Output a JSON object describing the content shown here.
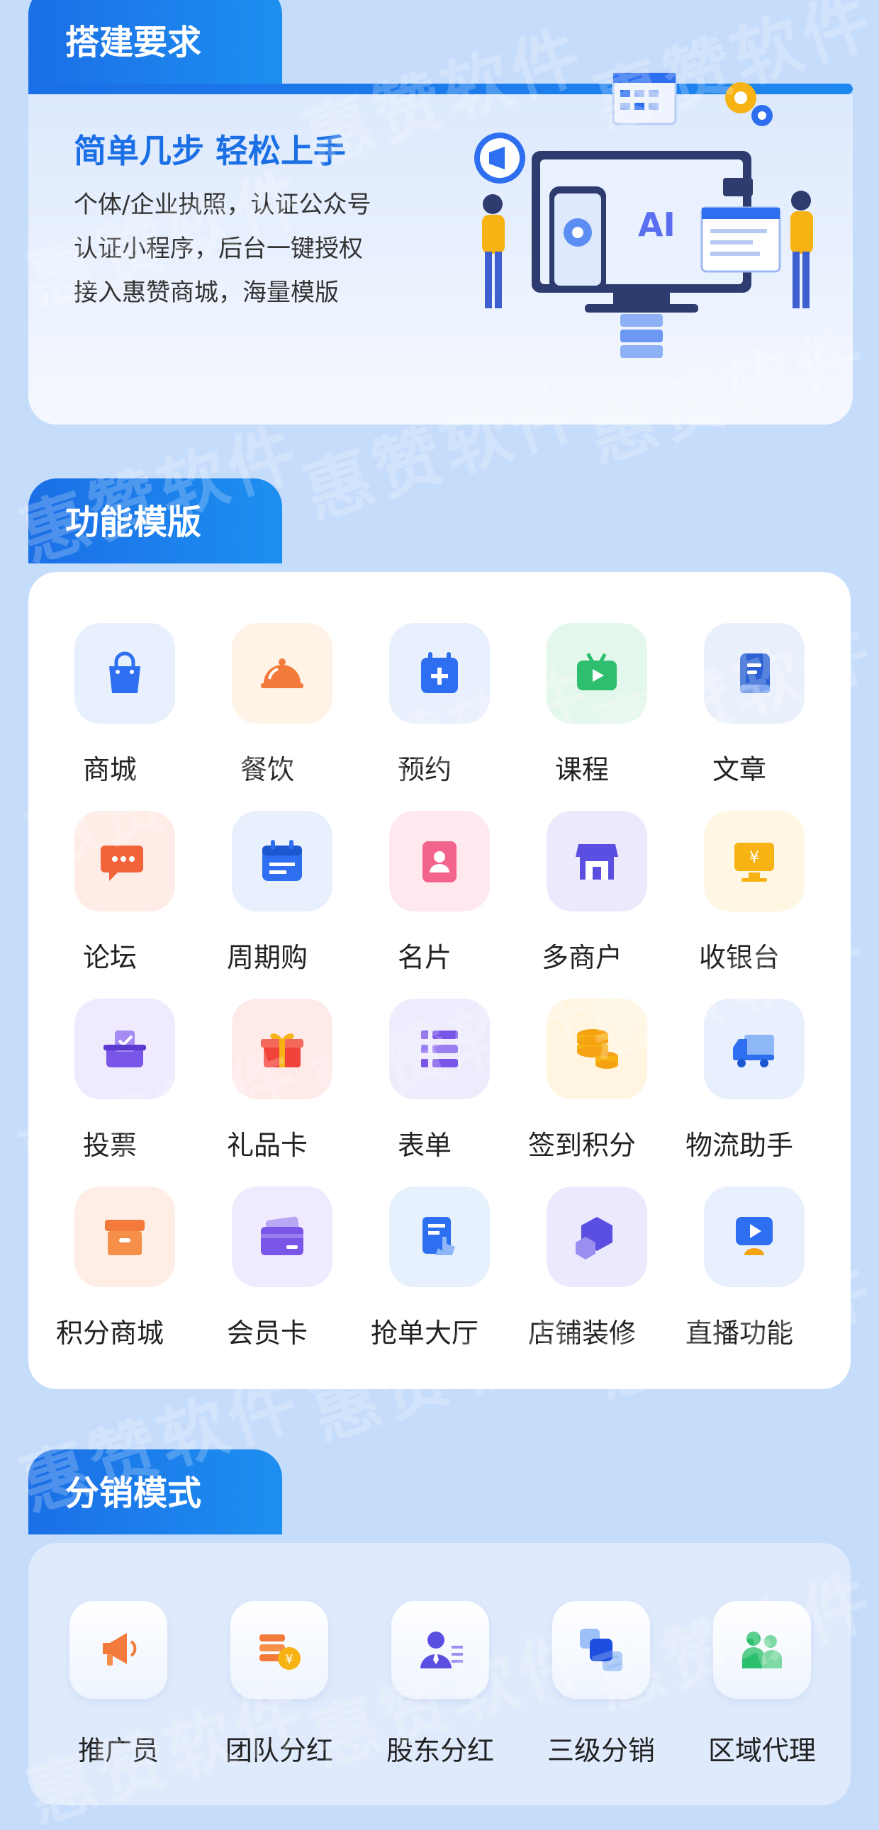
{
  "watermark": "惠赞软件",
  "section_setup": {
    "title": "搭建要求",
    "headline": "简单几步 轻松上手",
    "lines": [
      "个体/企业执照，认证公众号",
      "认证小程序，后台一键授权",
      "接入惠赞商城，海量模版"
    ],
    "illustration_text": "AI"
  },
  "section_templates": {
    "title": "功能模版",
    "items": [
      {
        "label": "商城",
        "icon": "shopping-bag-icon",
        "bg": "#e8effd"
      },
      {
        "label": "餐饮",
        "icon": "dining-cloche-icon",
        "bg": "#fff2e6"
      },
      {
        "label": "预约",
        "icon": "calendar-plus-icon",
        "bg": "#e8effd"
      },
      {
        "label": "课程",
        "icon": "tv-play-icon",
        "bg": "#e4f7ec"
      },
      {
        "label": "文章",
        "icon": "book-icon",
        "bg": "#eaf0fb"
      },
      {
        "label": "论坛",
        "icon": "chat-bubble-icon",
        "bg": "#ffece6"
      },
      {
        "label": "周期购",
        "icon": "calendar-icon",
        "bg": "#e8effd"
      },
      {
        "label": "名片",
        "icon": "id-card-icon",
        "bg": "#ffe9ee"
      },
      {
        "label": "多商户",
        "icon": "store-icon",
        "bg": "#ece9fd"
      },
      {
        "label": "收银台",
        "icon": "cashier-monitor-icon",
        "bg": "#fff7e3"
      },
      {
        "label": "投票",
        "icon": "ballot-box-icon",
        "bg": "#efeafd"
      },
      {
        "label": "礼品卡",
        "icon": "gift-icon",
        "bg": "#ffeaea"
      },
      {
        "label": "表单",
        "icon": "list-form-icon",
        "bg": "#eeebfd"
      },
      {
        "label": "签到积分",
        "icon": "coin-stack-icon",
        "bg": "#fff5e1"
      },
      {
        "label": "物流助手",
        "icon": "truck-icon",
        "bg": "#e8effd"
      },
      {
        "label": "积分商城",
        "icon": "storage-box-icon",
        "bg": "#ffeee6"
      },
      {
        "label": "会员卡",
        "icon": "member-card-icon",
        "bg": "#efeafd"
      },
      {
        "label": "抢单大厅",
        "icon": "order-tap-icon",
        "bg": "#e6f1fd"
      },
      {
        "label": "店铺装修",
        "icon": "cubes-icon",
        "bg": "#ebe9fd"
      },
      {
        "label": "直播功能",
        "icon": "live-play-icon",
        "bg": "#e8effd"
      }
    ]
  },
  "section_distribution": {
    "title": "分销模式",
    "items": [
      {
        "label": "推广员",
        "icon": "megaphone-icon"
      },
      {
        "label": "团队分红",
        "icon": "coins-yen-icon"
      },
      {
        "label": "股东分红",
        "icon": "shareholder-icon"
      },
      {
        "label": "三级分销",
        "icon": "linked-squares-icon"
      },
      {
        "label": "区域代理",
        "icon": "group-people-icon"
      }
    ]
  },
  "colors": {
    "page_bg": "#c6dcfb",
    "accent_blue": "#1b6fe6",
    "headline_blue": "#1a6fe5"
  }
}
